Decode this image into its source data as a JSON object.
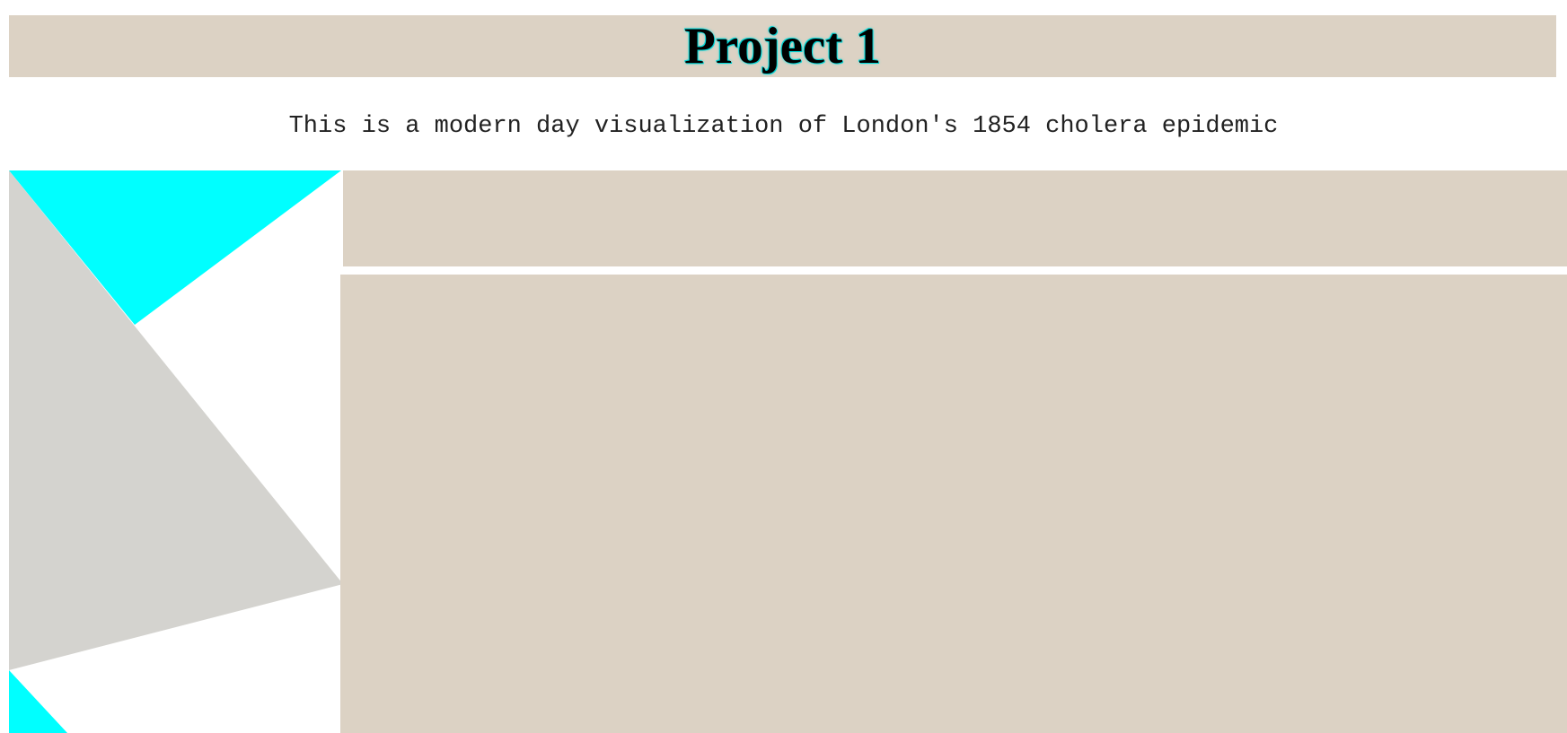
{
  "header": {
    "title": "Project 1",
    "subtitle": "This is a modern day visualization of London's 1854 cholera epidemic"
  },
  "colors": {
    "panel_bg": "#dcd2c4",
    "accent_cyan": "#00ffff",
    "shape_gray": "#d4d3cf"
  }
}
